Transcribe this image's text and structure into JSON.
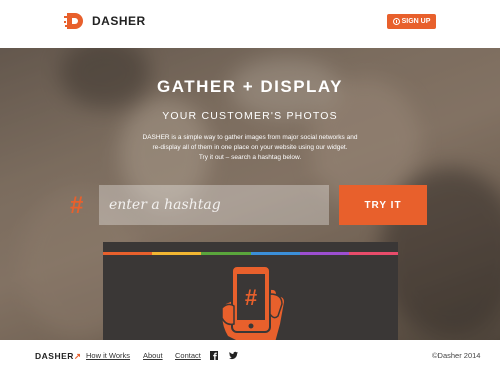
{
  "header": {
    "brand": "DASHER",
    "signup_label": "SIGN UP"
  },
  "hero": {
    "title": "GATHER + DISPLAY",
    "subtitle": "YOUR CUSTOMER'S PHOTOS",
    "description": [
      "DASHER is a simple way to gather images from major social networks and",
      "re-display all of them in one place on your website using our widget.",
      "Try it out – search a hashtag below."
    ],
    "hash_symbol": "#",
    "search_placeholder": "enter a hashtag",
    "search_value": "",
    "try_label": "TRY IT"
  },
  "widget": {
    "stripe_colors": [
      "#e8602c",
      "#f2b632",
      "#5aa63c",
      "#3b8fd9",
      "#9d4fd1",
      "#e84c6b"
    ],
    "icon": "phone-hashtag-icon"
  },
  "footer": {
    "brand": "DASHER",
    "links": [
      "How it Works",
      "About",
      "Contact"
    ],
    "social": [
      "facebook-icon",
      "twitter-icon"
    ],
    "copyright": "©Dasher 2014"
  },
  "colors": {
    "accent": "#e8602c",
    "dark": "#3a3736"
  }
}
